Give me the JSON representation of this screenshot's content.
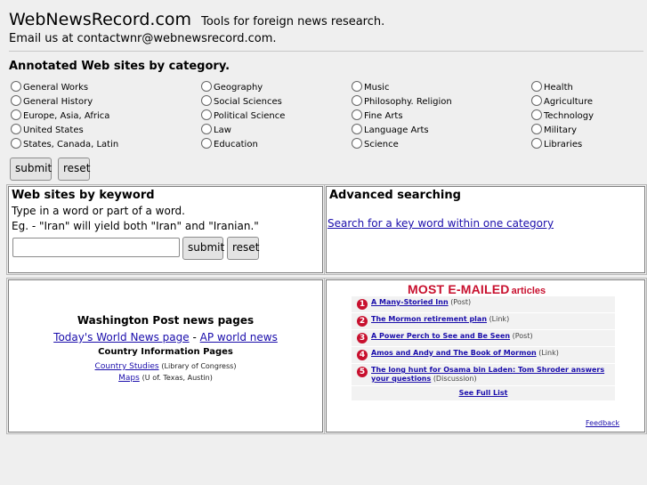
{
  "header": {
    "title": "WebNewsRecord.com",
    "tagline": "Tools for foreign news research.",
    "email": "Email us at contactwnr@webnewsrecord.com."
  },
  "categories": {
    "heading": "Annotated Web sites by category.",
    "columns": [
      [
        "General Works",
        "General History",
        "Europe, Asia, Africa",
        "United States",
        "States, Canada, Latin"
      ],
      [
        "Geography",
        "Social Sciences",
        "Political Science",
        "Law",
        "Education"
      ],
      [
        "Music",
        "Philosophy. Religion",
        "Fine Arts",
        "Language Arts",
        "Science"
      ],
      [
        "Health",
        "Agriculture",
        "Technology",
        "Military",
        "Libraries"
      ]
    ],
    "submit_label": "submit",
    "reset_label": "reset"
  },
  "keyword": {
    "title": "Web sites by keyword",
    "line1": "Type in a word or part of a word.",
    "line2": "Eg. - \"Iran\" will yield both \"Iran\" and \"Iranian.\"",
    "input_value": "",
    "submit_label": "submit",
    "reset_label": "reset"
  },
  "advanced": {
    "title": "Advanced searching",
    "link": "Search for a key word within one category"
  },
  "wapo": {
    "title": "Washington Post news pages",
    "link_world": "Today's World News page",
    "separator": "-",
    "link_ap": "AP world news",
    "country_heading": "Country Information Pages",
    "country_studies": "Country Studies",
    "country_studies_note": "(Library of Congress)",
    "maps": "Maps",
    "maps_note": "(U of. Texas, Austin)"
  },
  "most_emailed": {
    "title_big": "MOST E-MAILED",
    "title_small": "articles",
    "items": [
      {
        "num": "1",
        "title": "A Many-Storied Inn",
        "source": "(Post)"
      },
      {
        "num": "2",
        "title": "The Mormon retirement plan",
        "source": "(Link)"
      },
      {
        "num": "3",
        "title": "A Power Perch to See and Be Seen",
        "source": "(Post)"
      },
      {
        "num": "4",
        "title": "Amos and Andy and The Book of Mormon",
        "source": "(Link)"
      },
      {
        "num": "5",
        "title": "The long hunt for Osama bin Laden: Tom Shroder answers your questions",
        "source": "(Discussion)"
      }
    ],
    "full_list": "See Full List",
    "feedback": "Feedback"
  }
}
